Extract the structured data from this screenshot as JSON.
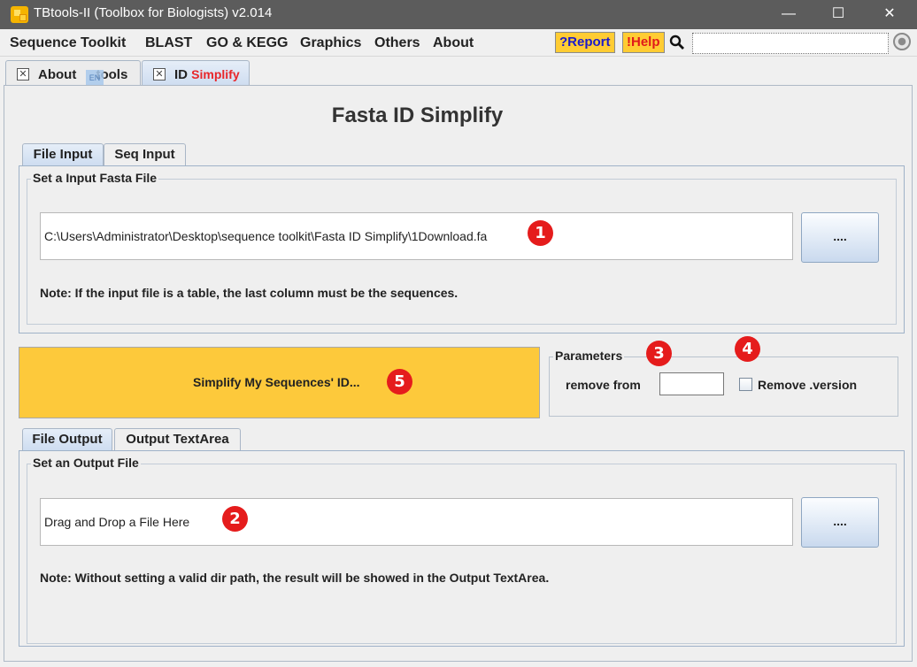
{
  "window": {
    "title": "TBtools-II (Toolbox for Biologists) v2.014",
    "minimize": "—",
    "maximize": "☐",
    "close": "✕"
  },
  "menubar": {
    "items": [
      "Sequence Toolkit",
      "BLAST",
      "GO & KEGG",
      "Graphics",
      "Others",
      "About"
    ],
    "report_label": "?Report",
    "help_label": "!Help",
    "search_value": "",
    "accent_color": "#ffcc33"
  },
  "doc_tabs": [
    {
      "label_prefix": "About ",
      "label_suffix": "tools",
      "ime_badge": "EN"
    },
    {
      "label_prefix": "ID ",
      "label_accent": "Simplify"
    }
  ],
  "main": {
    "title": "Fasta ID Simplify",
    "input_tabs": [
      "File Input",
      "Seq Input"
    ],
    "input_group_title": "Set a Input Fasta File",
    "input_path": "C:\\Users\\Administrator\\Desktop\\sequence toolkit\\Fasta ID Simplify\\1Download.fa",
    "input_browse_label": "....",
    "input_note": "Note: If the input file is a table, the last column must be the sequences.",
    "run_label": "Simplify My Sequences' ID...",
    "parameters": {
      "title": "Parameters",
      "remove_from_label": "remove from",
      "remove_from_value": "",
      "remove_version_label": "Remove .version",
      "remove_version_checked": false
    },
    "output_tabs": [
      "File Output",
      "Output TextArea"
    ],
    "output_group_title": "Set an Output File",
    "output_path": "Drag and Drop a File Here",
    "output_browse_label": "....",
    "output_note": "Note: Without setting a valid dir path, the result will be showed in the Output TextArea."
  },
  "markers": [
    "1",
    "2",
    "3",
    "4",
    "5"
  ],
  "colors": {
    "run_button": "#fdc93b",
    "marker": "#e51c1c",
    "titlebar": "#5c5c5c"
  }
}
